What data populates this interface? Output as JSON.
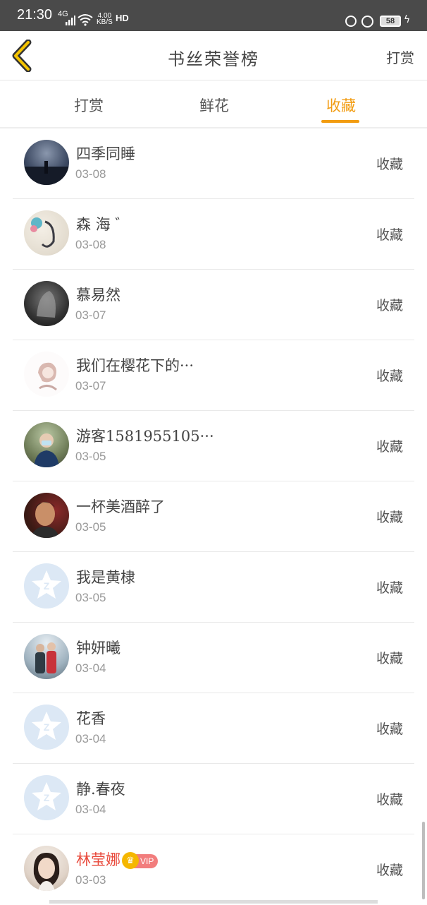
{
  "status_bar": {
    "time": "21:30",
    "network": "4G",
    "speed_top": "4.00",
    "speed_bottom": "KB/S",
    "hd": "HD",
    "battery": "58"
  },
  "header": {
    "title": "书丝荣誉榜",
    "action": "打赏",
    "back_icon": "chevron-left-icon"
  },
  "tabs": [
    {
      "label": "打赏",
      "active": false
    },
    {
      "label": "鲜花",
      "active": false
    },
    {
      "label": "收藏",
      "active": true
    }
  ],
  "colors": {
    "accent": "#f29c11",
    "vip_name": "#e8483a",
    "default_avatar": "#dce8f5"
  },
  "list": [
    {
      "name": "四季同睡",
      "date": "03-08",
      "action": "收藏",
      "avatar": "photo-night"
    },
    {
      "name": "森 海 ゛",
      "date": "03-08",
      "action": "收藏",
      "avatar": "illustration-girl"
    },
    {
      "name": "慕易然",
      "date": "03-07",
      "action": "收藏",
      "avatar": "photo-wolf"
    },
    {
      "name": "我们在樱花下的···",
      "date": "03-07",
      "action": "收藏",
      "avatar": "illustration-sketch"
    },
    {
      "name": "游客1581955105···",
      "date": "03-05",
      "action": "收藏",
      "avatar": "photo-person-mask"
    },
    {
      "name": "一杯美酒醉了",
      "date": "03-05",
      "action": "收藏",
      "avatar": "photo-man"
    },
    {
      "name": "我是黄棣",
      "date": "03-05",
      "action": "收藏",
      "avatar": "default-avatar-icon"
    },
    {
      "name": "钟妍曦",
      "date": "03-04",
      "action": "收藏",
      "avatar": "photo-couple"
    },
    {
      "name": "花香",
      "date": "03-04",
      "action": "收藏",
      "avatar": "default-avatar-icon"
    },
    {
      "name": "静.春夜",
      "date": "03-04",
      "action": "收藏",
      "avatar": "default-avatar-icon"
    },
    {
      "name": "林莹娜",
      "date": "03-03",
      "action": "收藏",
      "avatar": "photo-woman",
      "vip": true,
      "vip_label": "VIP"
    }
  ]
}
